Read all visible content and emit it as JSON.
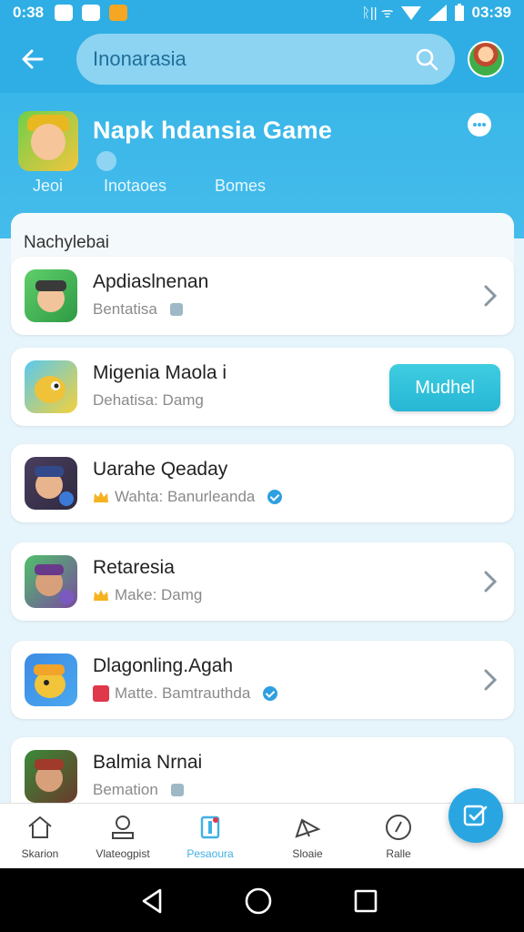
{
  "status_bar": {
    "time": "0:38",
    "clock": "03:39",
    "signal_text": "ᚱ|| ᯤ"
  },
  "app_bar": {
    "search_value": "Inonarasia"
  },
  "header": {
    "title": "Napk hdansia  Game",
    "tabs": [
      "Jeoi",
      "Inotaoes",
      "Bomes"
    ]
  },
  "section": {
    "title": "Nachylebai"
  },
  "items": [
    {
      "name": "Apdiaslnenan",
      "meta": "Bentatisa",
      "badge": "square",
      "trailing": "chevron"
    },
    {
      "name": "Migenia Maola i",
      "meta": "Dehatisa: Damg",
      "badge": "none",
      "trailing": "button",
      "button_label": "Mudhel"
    },
    {
      "name": "Uarahe Qeaday",
      "meta": "Wahta: Banurleanda",
      "badge": "crown-check",
      "trailing": "none"
    },
    {
      "name": "Retaresia",
      "meta": "Make: Damg",
      "badge": "crown",
      "trailing": "chevron"
    },
    {
      "name": "Dlagonling.Agah",
      "meta": "Matte. Bamtrauthda",
      "badge": "red-check",
      "trailing": "chevron"
    },
    {
      "name": "Balmia Nrnai",
      "meta": "Bemation",
      "badge": "square",
      "trailing": "none"
    }
  ],
  "bottom_nav": [
    {
      "label": "Skarion",
      "icon": "home-icon"
    },
    {
      "label": "Vlateogpist",
      "icon": "profile-icon"
    },
    {
      "label": "Pesaoura",
      "icon": "bookmark-icon"
    },
    {
      "label": "Sloaie",
      "icon": "share-icon"
    },
    {
      "label": "Ralle",
      "icon": "check-circle-icon"
    }
  ],
  "colors": {
    "primary": "#2eaee4",
    "accent_button": "#2fc3da",
    "background": "#e6f4fb"
  }
}
